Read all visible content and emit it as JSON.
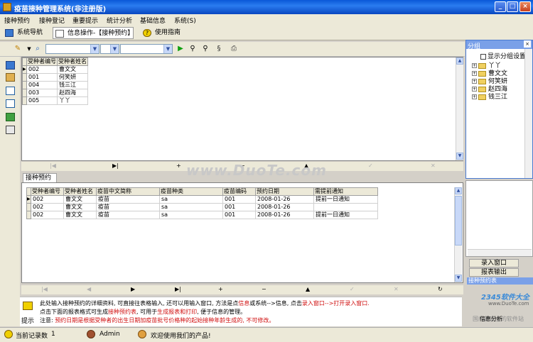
{
  "window": {
    "title": "疫苗接种管理系统(非注册版)",
    "min": "_",
    "max": "□",
    "close": "×"
  },
  "menu": [
    "接种预约",
    "接种登记",
    "重要提示",
    "统计分析",
    "基础信息",
    "系统(S)"
  ],
  "tabs": [
    "系统导航",
    "信息操作-【接种预约】",
    "使用指南"
  ],
  "toolbar": {
    "combo1": "",
    "combo2": "",
    "combo3": "",
    "combo4": ""
  },
  "top_grid": {
    "headers": [
      "受种者编号",
      "受种者姓名"
    ],
    "rows": [
      [
        "002",
        "曹文文"
      ],
      [
        "001",
        "何笑妍"
      ],
      [
        "004",
        "钱三江"
      ],
      [
        "003",
        "赵四海"
      ],
      [
        "005",
        "丫丫"
      ]
    ]
  },
  "nav_top": [
    "|◀",
    "◀",
    "▶",
    "▶|",
    "+",
    "−",
    "▲",
    "✓",
    "✕"
  ],
  "bottom_tab": "接种预约表",
  "bottom_grid": {
    "headers": [
      "受种者编号",
      "受种者姓名",
      "疫苗中文简称",
      "疫苗种类",
      "疫苗编码",
      "预约日期",
      "需提前通知"
    ],
    "rows": [
      [
        "002",
        "曹文文",
        "疫苗",
        "sa",
        "001",
        "2008-01-26",
        "提前一日通知"
      ],
      [
        "002",
        "曹文文",
        "疫苗",
        "sa",
        "001",
        "2008-01-26",
        ""
      ],
      [
        "002",
        "曹文文",
        "疫苗",
        "sa",
        "001",
        "2008-01-26",
        "提前一日通知"
      ]
    ]
  },
  "nav_bottom": [
    "|◀",
    "◀",
    "▶",
    "▶|",
    "+",
    "−",
    "▲",
    "✓",
    "✕",
    "↻"
  ],
  "tips": {
    "label": "提示",
    "line1a": "此处输入接种预约的详细资料, 可直接往表格输入, 还可以用输入窗口, 方法是点",
    "line1b": "信息",
    "line1c": "或系统-->信息, 点击",
    "line1d": "录入窗口",
    "line1e": "-->打开录入窗口.",
    "line2a": "点击下面的报表格式可生成",
    "line2b": "接种预约表",
    "line2c": ", 可用于",
    "line2d": "生成报表和打印",
    "line2e": ", 便于信息的管理。",
    "line3a": "注意: ",
    "line3b": "预约日期是根据受种者的出生日期加疫苗批号价格种的起始接种年龄生成的, 不可修改。"
  },
  "group": {
    "title": "分组",
    "show_settings": "显示分组设置",
    "items": [
      "丫丫",
      "曹文文",
      "何笑妍",
      "赵四海",
      "钱三江"
    ]
  },
  "right_buttons": [
    "录入窗口",
    "报表输出",
    "接种预约表"
  ],
  "right_bottom_label": "信息分析",
  "status": {
    "records_label": "当前记录数",
    "records": "1",
    "user": "Admin",
    "welcome": "欢迎使用我们的产品!"
  },
  "watermark": {
    "main": "www.DuoTe.com",
    "logo": "2345软件大全",
    "site": "www.DuoTe.com",
    "caption": "国内最安全的软件站"
  }
}
